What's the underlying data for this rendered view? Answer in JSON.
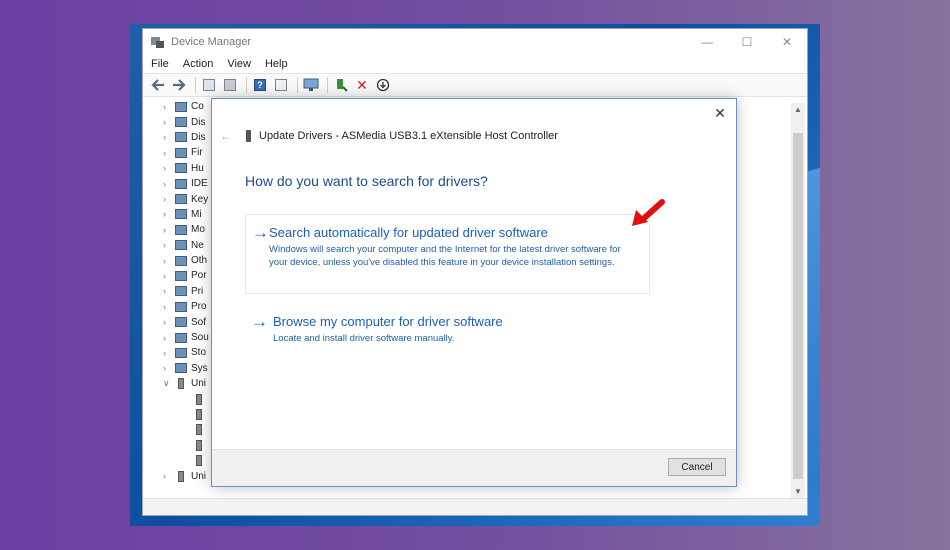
{
  "window": {
    "title": "Device Manager",
    "controls": {
      "minimize": "—",
      "maximize": "☐",
      "close": "✕"
    }
  },
  "menu": [
    "File",
    "Action",
    "View",
    "Help"
  ],
  "toolbar_icons": [
    "back-arrow-icon",
    "forward-arrow-icon",
    "properties-icon",
    "driver-icon",
    "help-icon",
    "view-icon",
    "monitor-icon",
    "update-driver-icon",
    "uninstall-icon",
    "scan-icon"
  ],
  "tree": [
    {
      "label": "Co",
      "icon": "computer-icon",
      "expanded": false
    },
    {
      "label": "Dis",
      "icon": "disk-icon",
      "expanded": false
    },
    {
      "label": "Dis",
      "icon": "display-icon",
      "expanded": false
    },
    {
      "label": "Fir",
      "icon": "firmware-icon",
      "expanded": false
    },
    {
      "label": "Hu",
      "icon": "hid-icon",
      "expanded": false
    },
    {
      "label": "IDE",
      "icon": "ide-icon",
      "expanded": false
    },
    {
      "label": "Key",
      "icon": "keyboard-icon",
      "expanded": false
    },
    {
      "label": "Mi",
      "icon": "mice-icon",
      "expanded": false
    },
    {
      "label": "Mo",
      "icon": "monitor-icon",
      "expanded": false
    },
    {
      "label": "Ne",
      "icon": "network-icon",
      "expanded": false
    },
    {
      "label": "Oth",
      "icon": "other-icon",
      "expanded": false
    },
    {
      "label": "Por",
      "icon": "ports-icon",
      "expanded": false
    },
    {
      "label": "Pri",
      "icon": "printer-icon",
      "expanded": false
    },
    {
      "label": "Pro",
      "icon": "processor-icon",
      "expanded": false
    },
    {
      "label": "Sof",
      "icon": "software-icon",
      "expanded": false
    },
    {
      "label": "Sou",
      "icon": "sound-icon",
      "expanded": false
    },
    {
      "label": "Sto",
      "icon": "storage-icon",
      "expanded": false
    },
    {
      "label": "Sys",
      "icon": "system-icon",
      "expanded": false
    },
    {
      "label": "Uni",
      "icon": "usb-icon",
      "expanded": true
    }
  ],
  "tree_last": {
    "label": "Uni",
    "icon": "usb-icon",
    "expanded": false
  },
  "dialog": {
    "title": "Update Drivers - ASMedia USB3.1 eXtensible Host Controller",
    "question": "How do you want to search for drivers?",
    "option1": {
      "title": "Search automatically for updated driver software",
      "description": "Windows will search your computer and the Internet for the latest driver software for your device, unless you've disabled this feature in your device installation settings."
    },
    "option2": {
      "title": "Browse my computer for driver software",
      "description": "Locate and install driver software manually."
    },
    "cancel": "Cancel",
    "close": "✕",
    "back": "←"
  },
  "colors": {
    "accent": "#1b5fb8",
    "arrow_red": "#e01010",
    "background": "#6b3fa3"
  }
}
